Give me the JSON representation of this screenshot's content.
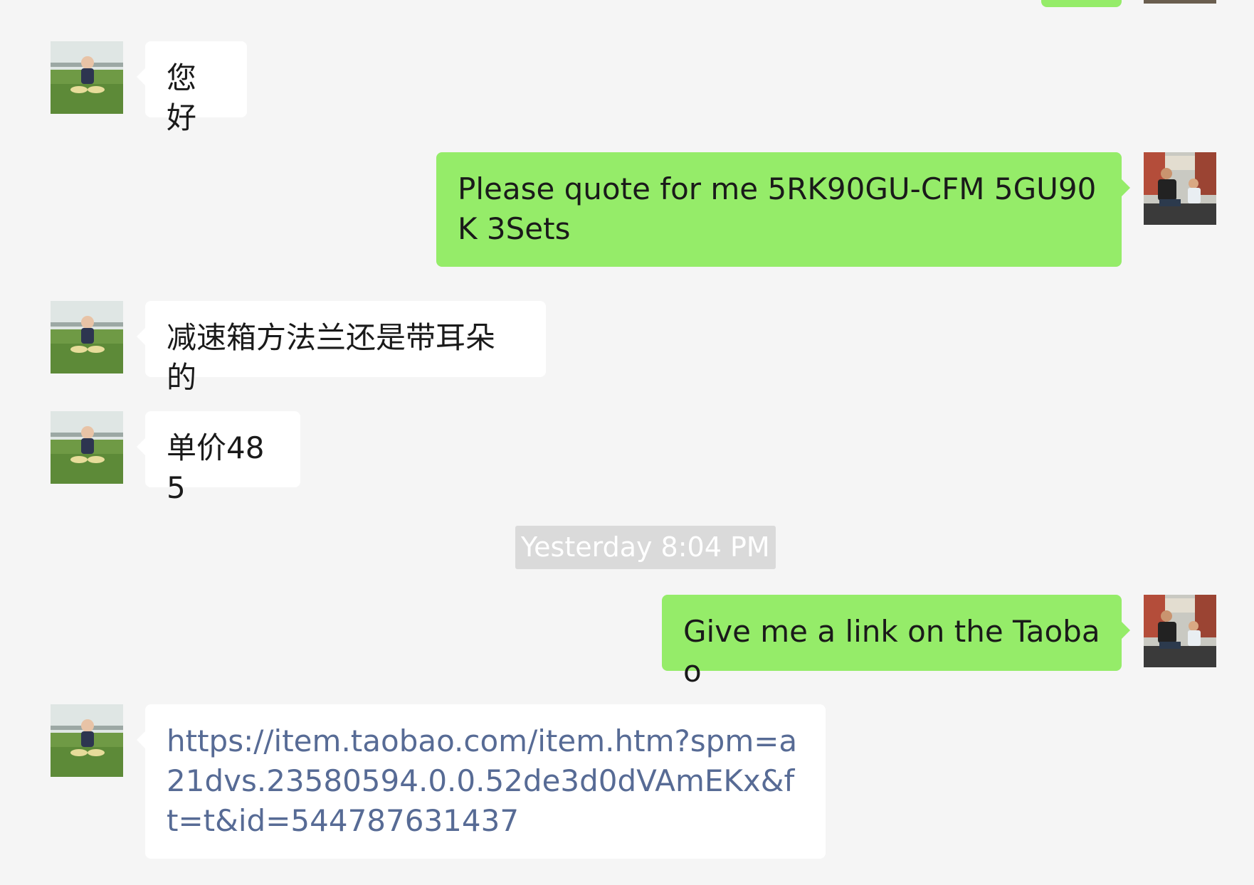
{
  "messages": [
    {
      "id": "m1",
      "direction": "incoming",
      "avatar": "baby-avatar",
      "text": "您好"
    },
    {
      "id": "m2",
      "direction": "outgoing",
      "avatar": "man-child-avatar",
      "text": "Please quote for me 5RK90GU-CFM 5GU90K 3Sets"
    },
    {
      "id": "m3",
      "direction": "incoming",
      "avatar": "baby-avatar",
      "text": "减速箱方法兰还是带耳朵的"
    },
    {
      "id": "m4",
      "direction": "incoming",
      "avatar": "baby-avatar",
      "text": "单价485"
    },
    {
      "id": "m5",
      "direction": "outgoing",
      "avatar": "man-child-avatar",
      "text": "Give me a link on the Taobao"
    },
    {
      "id": "m6",
      "direction": "incoming",
      "avatar": "baby-avatar",
      "text": "https://item.taobao.com/item.htm?spm=a21dvs.23580594.0.0.52de3d0dVAmEKx&ft=t&id=544787631437"
    }
  ],
  "timestamp": "Yesterday 8:04 PM",
  "colors": {
    "background": "#f5f5f5",
    "incoming_bubble": "#ffffff",
    "outgoing_bubble": "#95ec69",
    "link_text": "#576b95",
    "timestamp_bg": "#dadada",
    "timestamp_text": "#ffffff"
  }
}
